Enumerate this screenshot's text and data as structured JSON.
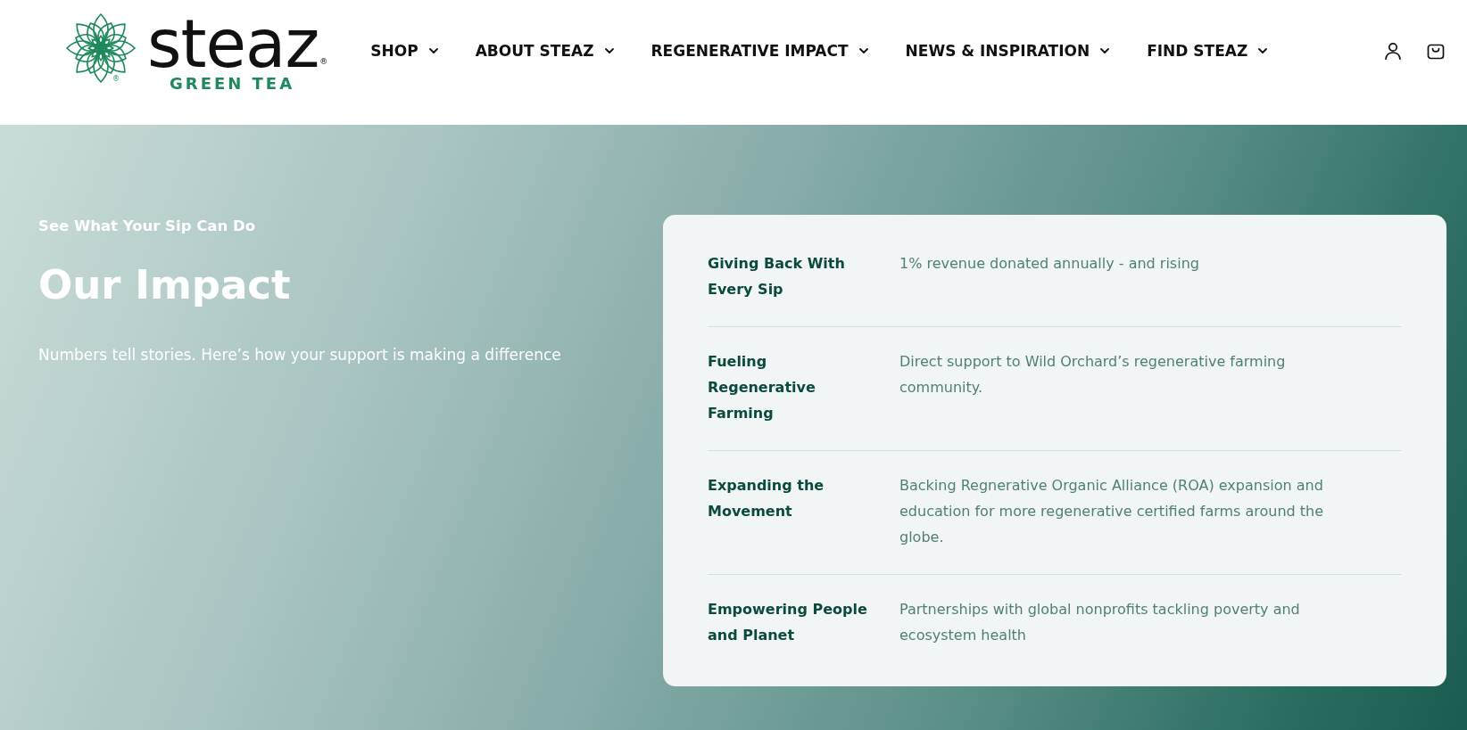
{
  "header": {
    "logo": {
      "wordmark": "steaz",
      "wordmark_mark": "®",
      "emblem_mark": "®",
      "tagline": "GREEN TEA"
    },
    "nav": [
      {
        "label": "SHOP"
      },
      {
        "label": "ABOUT STEAZ"
      },
      {
        "label": "REGENERATIVE IMPACT"
      },
      {
        "label": "NEWS & INSPIRATION"
      },
      {
        "label": "FIND STEAZ"
      }
    ]
  },
  "hero": {
    "eyebrow": "See What Your Sip Can Do",
    "title": "Our Impact",
    "subtitle": "Numbers tell stories. Here’s how your support is making a difference"
  },
  "impact_card": {
    "rows": [
      {
        "label": "Giving Back With Every Sip",
        "value": "1% revenue donated annually - and rising"
      },
      {
        "label": "Fueling Regenerative Farming",
        "value": "Direct support to Wild Orchard’s regenerative farming community."
      },
      {
        "label": "Expanding the Movement",
        "value": "Backing Regnerative Organic Alliance (ROA) expansion and education for more regenerative certified farms around the globe."
      },
      {
        "label": "Empowering People and Planet",
        "value": "Partnerships with global nonprofits tackling poverty and ecosystem health"
      }
    ]
  }
}
